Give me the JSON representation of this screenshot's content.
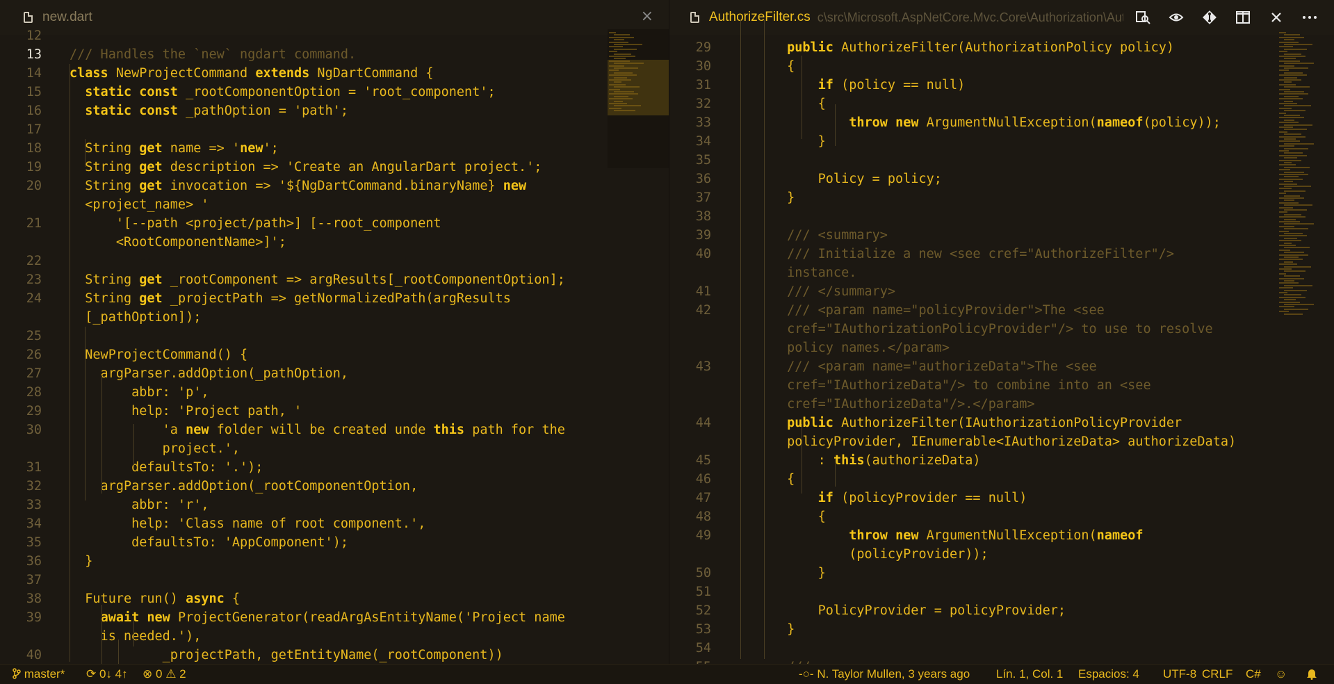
{
  "left_tab": {
    "title": "new.dart",
    "close": "×"
  },
  "right_tab": {
    "title": "AuthorizeFilter.cs",
    "path": "c\\src\\Microsoft.AspNetCore.Mvc.Core\\Authorization\\Authc"
  },
  "right_actions": [
    "open-changes-icon",
    "go-to-previous-icon",
    "git-compare-icon",
    "split-editor-icon",
    "close-icon",
    "more-icon"
  ],
  "left_lines": [
    {
      "n": "12",
      "t": ""
    },
    {
      "n": "13",
      "t": "/// Handles the `new` ngdart command.",
      "cls": "cm"
    },
    {
      "n": "14",
      "t": "class NewProjectCommand extends NgDartCommand {"
    },
    {
      "n": "15",
      "t": "  static const _rootComponentOption = 'root_component';"
    },
    {
      "n": "16",
      "t": "  static const _pathOption = 'path';"
    },
    {
      "n": "17",
      "t": ""
    },
    {
      "n": "18",
      "t": "  String get name => 'new';"
    },
    {
      "n": "19",
      "t": "  String get description => 'Create an AngularDart project.';"
    },
    {
      "n": "20",
      "t": "  String get invocation => '${NgDartCommand.binaryName} new"
    },
    {
      "n": "",
      "t": "  <project_name> '"
    },
    {
      "n": "21",
      "t": "      '[--path <project/path>] [--root_component"
    },
    {
      "n": "",
      "t": "      <RootComponentName>]';"
    },
    {
      "n": "22",
      "t": ""
    },
    {
      "n": "23",
      "t": "  String get _rootComponent => argResults[_rootComponentOption];"
    },
    {
      "n": "24",
      "t": "  String get _projectPath => getNormalizedPath(argResults"
    },
    {
      "n": "",
      "t": "  [_pathOption]);"
    },
    {
      "n": "25",
      "t": ""
    },
    {
      "n": "26",
      "t": "  NewProjectCommand() {"
    },
    {
      "n": "27",
      "t": "    argParser.addOption(_pathOption,"
    },
    {
      "n": "28",
      "t": "        abbr: 'p',"
    },
    {
      "n": "29",
      "t": "        help: 'Project path, '"
    },
    {
      "n": "30",
      "t": "            'a new folder will be created unde this path for the"
    },
    {
      "n": "",
      "t": "            project.',"
    },
    {
      "n": "31",
      "t": "        defaultsTo: '.');"
    },
    {
      "n": "32",
      "t": "    argParser.addOption(_rootComponentOption,"
    },
    {
      "n": "33",
      "t": "        abbr: 'r',"
    },
    {
      "n": "34",
      "t": "        help: 'Class name of root component.',"
    },
    {
      "n": "35",
      "t": "        defaultsTo: 'AppComponent');"
    },
    {
      "n": "36",
      "t": "  }"
    },
    {
      "n": "37",
      "t": ""
    },
    {
      "n": "38",
      "t": "  Future run() async {"
    },
    {
      "n": "39",
      "t": "    await new ProjectGenerator(readArgAsEntityName('Project name"
    },
    {
      "n": "",
      "t": "    is needed.'),"
    },
    {
      "n": "40",
      "t": "            _projectPath, getEntityName(_rootComponent))"
    }
  ],
  "right_lines": [
    {
      "n": "",
      "t": ""
    },
    {
      "n": "29",
      "t": "        public AuthorizeFilter(AuthorizationPolicy policy)"
    },
    {
      "n": "30",
      "t": "        {"
    },
    {
      "n": "31",
      "t": "            if (policy == null)"
    },
    {
      "n": "32",
      "t": "            {"
    },
    {
      "n": "33",
      "t": "                throw new ArgumentNullException(nameof(policy));"
    },
    {
      "n": "34",
      "t": "            }"
    },
    {
      "n": "35",
      "t": ""
    },
    {
      "n": "36",
      "t": "            Policy = policy;"
    },
    {
      "n": "37",
      "t": "        }"
    },
    {
      "n": "38",
      "t": ""
    },
    {
      "n": "39",
      "t": "        /// <summary>",
      "cls": "cm"
    },
    {
      "n": "40",
      "t": "        /// Initialize a new <see cref=\"AuthorizeFilter\"/>",
      "cls": "cm"
    },
    {
      "n": "",
      "t": "        instance.",
      "cls": "cm"
    },
    {
      "n": "41",
      "t": "        /// </summary>",
      "cls": "cm"
    },
    {
      "n": "42",
      "t": "        /// <param name=\"policyProvider\">The <see",
      "cls": "cm"
    },
    {
      "n": "",
      "t": "        cref=\"IAuthorizationPolicyProvider\"/> to use to resolve",
      "cls": "cm"
    },
    {
      "n": "",
      "t": "        policy names.</param>",
      "cls": "cm"
    },
    {
      "n": "43",
      "t": "        /// <param name=\"authorizeData\">The <see",
      "cls": "cm"
    },
    {
      "n": "",
      "t": "        cref=\"IAuthorizeData\"/> to combine into an <see",
      "cls": "cm"
    },
    {
      "n": "",
      "t": "        cref=\"IAuthorizeData\"/>.</param>",
      "cls": "cm"
    },
    {
      "n": "44",
      "t": "        public AuthorizeFilter(IAuthorizationPolicyProvider"
    },
    {
      "n": "",
      "t": "        policyProvider, IEnumerable<IAuthorizeData> authorizeData)"
    },
    {
      "n": "45",
      "t": "            : this(authorizeData)"
    },
    {
      "n": "46",
      "t": "        {"
    },
    {
      "n": "47",
      "t": "            if (policyProvider == null)"
    },
    {
      "n": "48",
      "t": "            {"
    },
    {
      "n": "49",
      "t": "                throw new ArgumentNullException(nameof"
    },
    {
      "n": "",
      "t": "                (policyProvider));"
    },
    {
      "n": "50",
      "t": "            }"
    },
    {
      "n": "51",
      "t": ""
    },
    {
      "n": "52",
      "t": "            PolicyProvider = policyProvider;"
    },
    {
      "n": "53",
      "t": "        }"
    },
    {
      "n": "54",
      "t": ""
    },
    {
      "n": "55",
      "t": "        ///",
      "cls": "cm"
    }
  ],
  "status": {
    "branch": "master*",
    "sync": "0↓ 4↑",
    "errors": "0",
    "warnings": "2",
    "blame": "N. Taylor Mullen, 3 years ago",
    "position": "Lín. 1, Col. 1",
    "indent": "Espacios: 4",
    "encoding": "UTF-8",
    "eol": "CRLF",
    "language": "C#"
  },
  "colors": {
    "accent": "#e8b81e",
    "background": "#1c1812",
    "comment": "#6d5a2b"
  }
}
